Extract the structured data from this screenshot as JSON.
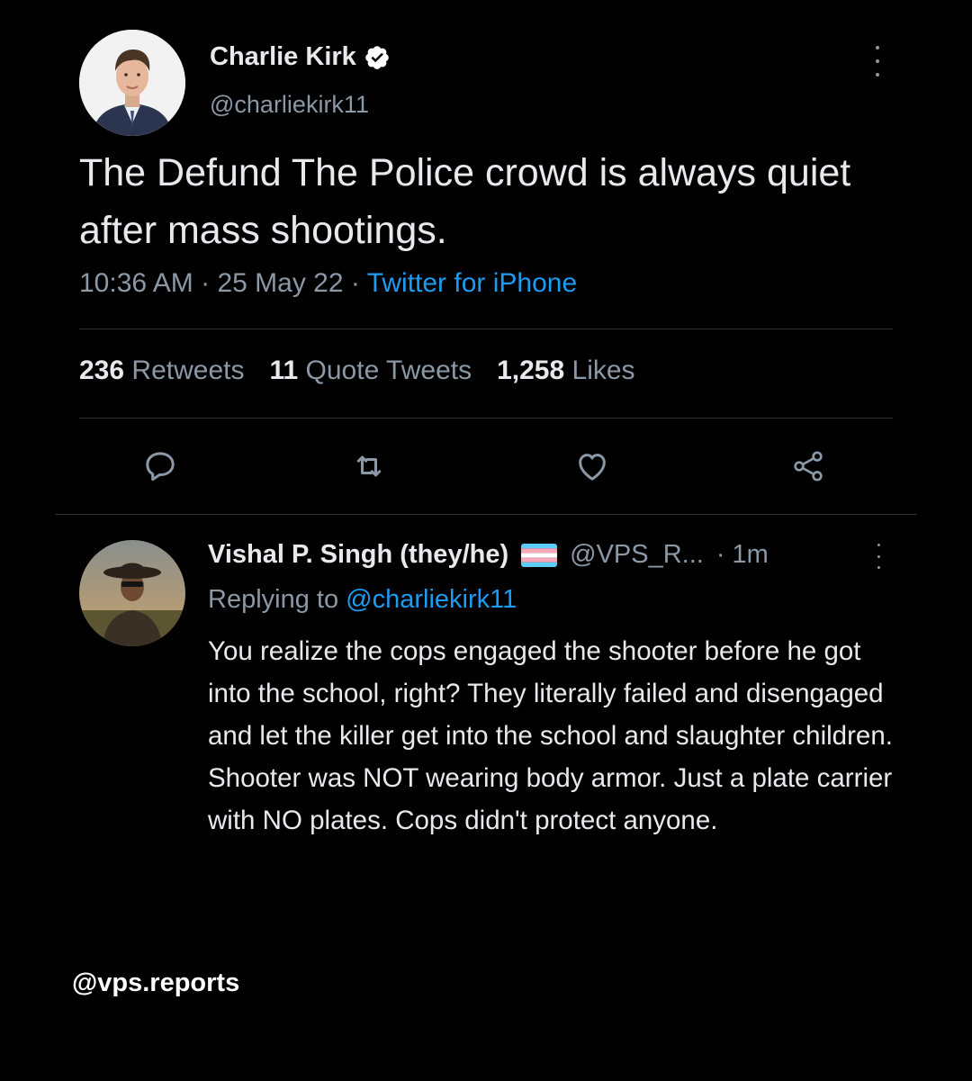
{
  "main_tweet": {
    "author_name": "Charlie Kirk",
    "handle": "@charliekirk11",
    "verified": true,
    "text": "The Defund The Police crowd is always quiet after mass shootings.",
    "time": "10:36 AM",
    "date": "25 May 22",
    "separator": "·",
    "source": "Twitter for iPhone",
    "stats": {
      "retweets_count": "236",
      "retweets_label": "Retweets",
      "quotes_count": "11",
      "quotes_label": "Quote Tweets",
      "likes_count": "1,258",
      "likes_label": "Likes"
    },
    "actions": [
      "reply-icon",
      "retweet-icon",
      "like-icon",
      "share-icon"
    ]
  },
  "reply": {
    "author_name": "Vishal P. Singh (they/he)",
    "flag_icon": "transgender-flag",
    "handle": "@VPS_R...",
    "time": "· 1m",
    "replying_prefix": "Replying to",
    "replying_to": "@charliekirk11",
    "text": "You realize the cops engaged the shooter before he got into the school, right? They literally failed and disengaged and let the killer get into the school and slaughter children. Shooter was NOT wearing body armor. Just a plate carrier with NO plates. Cops didn't protect anyone."
  },
  "watermark": "@vps.reports",
  "colors": {
    "background": "#000000",
    "primary_text": "#e7e9ea",
    "secondary_text": "#8b98a5",
    "link": "#1d9bf0",
    "divider": "#2f3336",
    "verified": "#ffffff"
  }
}
